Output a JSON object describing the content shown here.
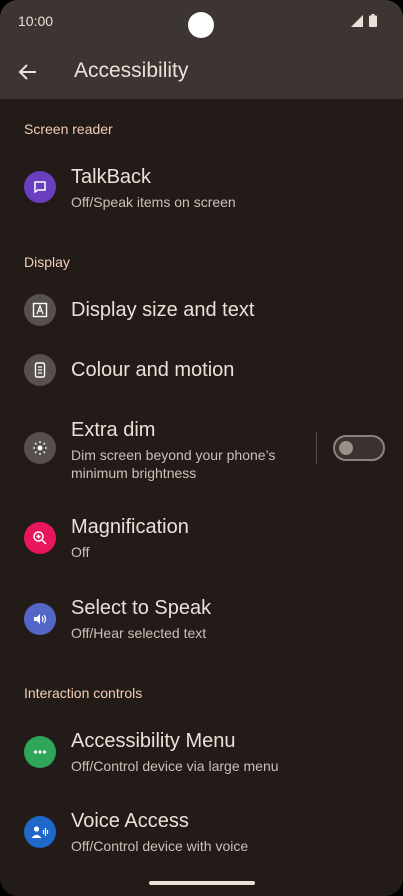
{
  "status": {
    "time": "10:00"
  },
  "appbar": {
    "title": "Accessibility"
  },
  "sections": {
    "screen_reader": "Screen reader",
    "display": "Display",
    "interaction": "Interaction controls"
  },
  "items": {
    "talkback": {
      "title": "TalkBack",
      "subtitle": "Off/Speak items on screen",
      "icon_color": "#6a3fbf"
    },
    "display_size": {
      "title": "Display size and text",
      "icon_color": "#57504c"
    },
    "colour_motion": {
      "title": "Colour and motion",
      "icon_color": "#57504c"
    },
    "extra_dim": {
      "title": "Extra dim",
      "subtitle": "Dim screen beyond your phone’s minimum brightness",
      "icon_color": "#57504c",
      "toggle": "off"
    },
    "magnification": {
      "title": "Magnification",
      "subtitle": "Off",
      "icon_color": "#e8175d"
    },
    "select_to_speak": {
      "title": "Select to Speak",
      "subtitle": "Off/Hear selected text",
      "icon_color": "#5467c9"
    },
    "accessibility_menu": {
      "title": "Accessibility Menu",
      "subtitle": "Off/Control device via large menu",
      "icon_color": "#2fa658"
    },
    "voice_access": {
      "title": "Voice Access",
      "subtitle": "Off/Control device with voice",
      "icon_color": "#1f67c9"
    }
  }
}
